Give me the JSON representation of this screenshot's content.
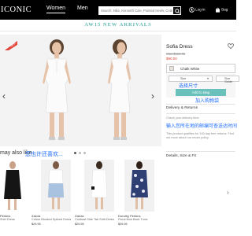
{
  "header": {
    "brand": "ICONIC",
    "nav": [
      "Women",
      "Men"
    ],
    "search_placeholder": "Search: Nike, Kenneth Cole, Pointed Heels, Cotton Rib",
    "login": "Log in",
    "bag": "Bag"
  },
  "banner": "AW15 NEW ARRIVALS",
  "gallery": {
    "badge": "NEW",
    "dots": 3,
    "active_dot": 0
  },
  "product": {
    "name": "Sofia Dress",
    "was_price": "Was $119.95",
    "now_price": "$90.00",
    "color": "Chalk White",
    "size_label": "Size",
    "size_guide": "Size Guide",
    "zh_size": "选择尺寸",
    "add_button": "Add to Bag",
    "zh_add": "加入购物袋",
    "delivery_heading": "Delivery & Returns",
    "check_delivery": "Check your delivery time",
    "zh_delivery": "输入您所在地的邮编可查送达时间",
    "free_returns": "This product qualifies for 100 day free returns. Find out more about our return policy.",
    "details_heading": "Details, Size & Fit"
  },
  "also_like": {
    "title": "may also like",
    "zh_title": "您也许还喜欢...",
    "items": [
      {
        "brand": "Perkins",
        "desc": "Shirt Dress",
        "price": ""
      },
      {
        "brand": "Zalora",
        "desc": "Colour Blocked Spliced Dress",
        "price": "$29.95"
      },
      {
        "brand": "Zalora",
        "desc": "Contrast Side Tab Shift Dress",
        "price": "$29.95"
      },
      {
        "brand": "Dorothy Perkins",
        "desc": "Floral Bow Back Tunic",
        "price": "$39.95"
      }
    ]
  },
  "colors": {
    "accent": "#6ac0ba",
    "banner": "#5ab7b0",
    "sale": "#dd4433",
    "annotation": "#1e6cff"
  }
}
